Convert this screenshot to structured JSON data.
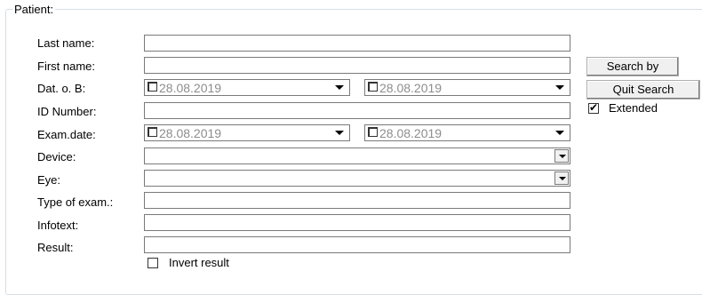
{
  "group": {
    "title": "Patient:"
  },
  "labels": {
    "last_name": "Last name:",
    "first_name": "First name:",
    "dob": "Dat. o. B:",
    "id_number": "ID Number:",
    "exam_date": "Exam.date:",
    "device": "Device:",
    "eye": "Eye:",
    "type_of_exam": "Type of exam.:",
    "infotext": "Infotext:",
    "result": "Result:"
  },
  "fields": {
    "last_name": "",
    "first_name": "",
    "id_number": "",
    "device": "",
    "eye": "",
    "type_of_exam": "",
    "infotext": "",
    "result": ""
  },
  "dates": {
    "dob_from": "28.08.2019",
    "dob_to": "28.08.2019",
    "exam_from": "28.08.2019",
    "exam_to": "28.08.2019"
  },
  "buttons": {
    "search_by": "Search by",
    "quit_search": "Quit Search"
  },
  "checkboxes": {
    "extended": {
      "label": "Extended",
      "checked": true
    },
    "invert_result": {
      "label": "Invert result",
      "checked": false
    }
  }
}
